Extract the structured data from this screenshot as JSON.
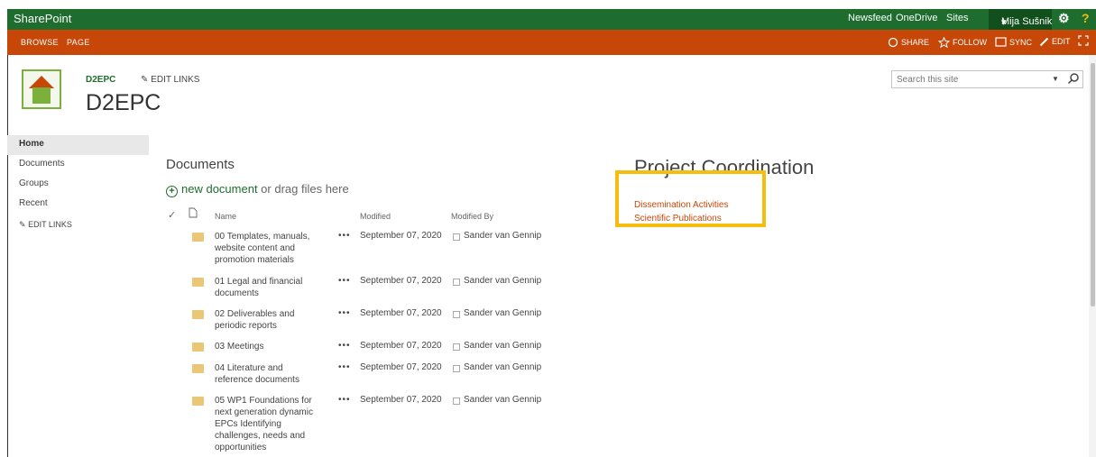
{
  "suitebar": {
    "brand": "SharePoint",
    "newsfeed": "Newsfeed",
    "onedrive": "OneDrive",
    "sites": "Sites",
    "user": "Mija Sušnik",
    "settings_icon": "gear-icon",
    "help_icon": "help-icon"
  },
  "ribbon": {
    "browse": "BROWSE",
    "page": "PAGE",
    "share": "SHARE",
    "follow": "FOLLOW",
    "sync": "SYNC",
    "edit": "EDIT"
  },
  "site": {
    "small_title": "D2EPC",
    "edit_links": "EDIT LINKS",
    "title": "D2EPC"
  },
  "search": {
    "placeholder": "Search this site"
  },
  "leftnav": {
    "items": [
      {
        "label": "Home",
        "active": true
      },
      {
        "label": "Documents"
      },
      {
        "label": "Groups"
      },
      {
        "label": "Recent"
      }
    ],
    "edit_links": "EDIT LINKS"
  },
  "documents": {
    "title": "Documents",
    "new_document": "new document",
    "or_drag": " or drag files here",
    "columns": {
      "name": "Name",
      "modified": "Modified",
      "modified_by": "Modified By"
    },
    "rows": [
      {
        "name": "00 Templates, manuals, website content and promotion materials",
        "modified": "September 07, 2020",
        "by": "Sander van Gennip"
      },
      {
        "name": "01 Legal and financial documents",
        "modified": "September 07, 2020",
        "by": "Sander van Gennip"
      },
      {
        "name": "02 Deliverables and periodic reports",
        "modified": "September 07, 2020",
        "by": "Sander van Gennip"
      },
      {
        "name": "03 Meetings",
        "modified": "September 07, 2020",
        "by": "Sander van Gennip"
      },
      {
        "name": "04 Literature and reference documents",
        "modified": "September 07, 2020",
        "by": "Sander van Gennip"
      },
      {
        "name": "05 WP1 Foundations for next generation dynamic EPCs Identifying challenges, needs and opportunities",
        "modified": "September 07, 2020",
        "by": "Sander van Gennip"
      }
    ]
  },
  "project": {
    "title": "Project Coordination",
    "links": [
      "Dissemination Activities",
      "Scientific Publications"
    ]
  },
  "colors": {
    "suitebar": "#1e6d2e",
    "ribbon": "#c64707",
    "highlight": "#f5bd0d"
  }
}
